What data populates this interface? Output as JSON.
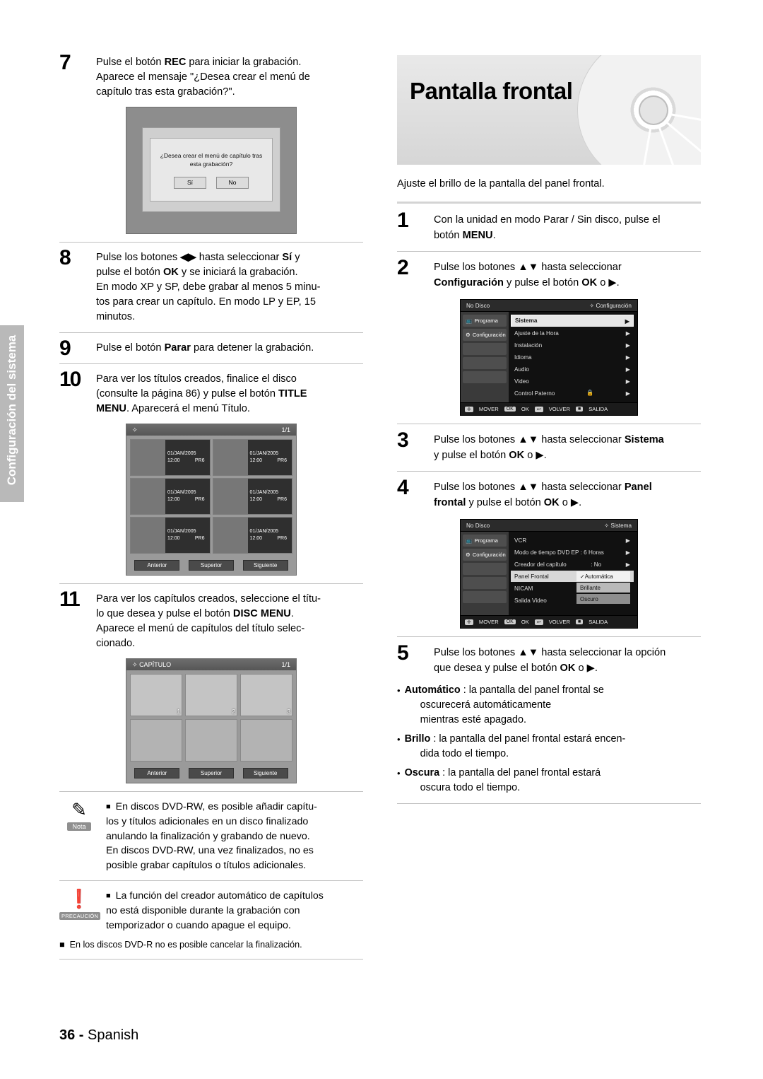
{
  "header": {
    "title": "Pantalla frontal",
    "intro": "Ajuste el brillo de la pantalla del panel frontal."
  },
  "left_steps": [
    {
      "num": "7",
      "lines": [
        "Pulse el botón REC para iniciar la grabación.",
        "Aparece el mensaje \"¿Desea crear el menú de",
        "capítulo tras esta grabación?\"."
      ]
    },
    {
      "num": "8",
      "lines": [
        "Pulse los botones ◀ ▶ hasta seleccionar Sí y",
        "pulse el botón OK y se iniciará la grabación.",
        "En modo XP y SP, debe grabar al menos 5 minu-",
        "tos para crear un capítulo. En modo LP y EP, 15",
        "minutos."
      ]
    },
    {
      "num": "9",
      "lines": [
        "Pulse el botón Parar para detener la grabación."
      ]
    },
    {
      "num": "10",
      "lines": [
        "Para ver los títulos creados, finalice el disco",
        "(consulte la página 86) y pulse el botón TITLE",
        "MENU. Aparecerá el menú Título."
      ]
    },
    {
      "num": "11",
      "lines": [
        "Para ver los capítulos creados, seleccione el títu-",
        "lo que desea y pulse el botón DISC MENU.",
        "Aparece el menú de capítulos del título selec-",
        "cionado."
      ]
    }
  ],
  "dialog_figure": {
    "line1": "¿Desea crear el menú de capítulo tras",
    "line2": "esta grabación?",
    "yes": "Sí",
    "no": "No"
  },
  "title_menu_figure": {
    "page": "1/1",
    "marker": "✧",
    "thumbs": [
      {
        "date": "01/JAN/2005",
        "time": "12:00",
        "mode": "PR6"
      },
      {
        "date": "01/JAN/2005",
        "time": "12:00",
        "mode": "PR6"
      },
      {
        "date": "01/JAN/2005",
        "time": "12:00",
        "mode": "PR6"
      },
      {
        "date": "01/JAN/2005",
        "time": "12:00",
        "mode": "PR6"
      },
      {
        "date": "01/JAN/2005",
        "time": "12:00",
        "mode": "PR6"
      },
      {
        "date": "01/JAN/2005",
        "time": "12:00",
        "mode": "PR6"
      }
    ],
    "nav": [
      "Anterior",
      "Superior",
      "Siguiente"
    ]
  },
  "chapter_menu_figure": {
    "title": "CAPÍTULO",
    "marker": "✧",
    "page": "1/1",
    "cells": [
      "1",
      "2",
      "3"
    ],
    "nav": [
      "Anterior",
      "Superior",
      "Siguiente"
    ]
  },
  "note_box": {
    "label": "Nota",
    "lines": [
      "En discos DVD-RW, es posible añadir capítu-",
      "los y títulos adicionales en un disco finalizado",
      "anulando la finalización y grabando de nuevo.",
      "En discos DVD-RW, una vez finalizados, no es",
      "posible grabar capítulos o títulos adicionales."
    ]
  },
  "caution_box": {
    "label": "PRECAUCIÓN",
    "lines": [
      "La función del creador automático de capítulos",
      "no está disponible durante la grabación con",
      "temporizador o cuando apague el equipo."
    ],
    "extra": "En los discos DVD-R no es posible cancelar la finalización."
  },
  "right_steps": [
    {
      "num": "1",
      "lines": [
        "Con la unidad en modo Parar / Sin disco, pulse el",
        "botón MENU."
      ]
    },
    {
      "num": "2",
      "lines": [
        "Pulse los botones ▲▼ hasta seleccionar",
        "Configuración y pulse el botón OK o ▶."
      ]
    },
    {
      "num": "3",
      "lines": [
        "Pulse los botones ▲▼ hasta seleccionar Sistema",
        "y pulse el botón OK o ▶."
      ]
    },
    {
      "num": "4",
      "lines": [
        "Pulse los botones ▲▼ hasta seleccionar Panel",
        "frontal y pulse el botón OK o ▶."
      ]
    },
    {
      "num": "5",
      "lines": [
        "Pulse los botones ▲▼ hasta seleccionar la opción",
        "que desea y pulse el botón OK o ▶."
      ]
    }
  ],
  "osd_setup": {
    "status": "No Disco",
    "title": "Configuración",
    "title_marker": "✧",
    "left_items": [
      "Programa",
      "Configuración"
    ],
    "rows": [
      {
        "label": "Sistema",
        "arrow": "▶",
        "selected": true
      },
      {
        "label": "Ajuste de la Hora",
        "arrow": "▶",
        "selected": false
      },
      {
        "label": "Instalación",
        "arrow": "▶",
        "selected": false
      },
      {
        "label": "Idioma",
        "arrow": "▶",
        "selected": false
      },
      {
        "label": "Audio",
        "arrow": "▶",
        "selected": false
      },
      {
        "label": "Video",
        "arrow": "▶",
        "selected": false
      },
      {
        "label": "Control Paterno",
        "arrow": "▶",
        "selected": false,
        "lock": true
      }
    ],
    "footer": [
      {
        "key": "✛",
        "label": "MOVER"
      },
      {
        "key": "OK",
        "label": "OK"
      },
      {
        "key": "↩",
        "label": "VOLVER"
      },
      {
        "key": "■",
        "label": "SALIDA"
      }
    ]
  },
  "osd_system": {
    "status": "No Disco",
    "title": "Sistema",
    "title_marker": "✧",
    "left_items": [
      "Programa",
      "Configuración"
    ],
    "rows": [
      {
        "label": "VCR",
        "arrow": "▶"
      },
      {
        "label": "Modo de tiempo DVD EP : 6 Horas",
        "arrow": "▶"
      },
      {
        "label": "Creador del capítulo",
        "value": ": No",
        "arrow": "▶"
      },
      {
        "label": "Panel Frontal",
        "arrow": "▶",
        "highlight": true
      },
      {
        "label": "NICAM",
        "arrow": "▶"
      },
      {
        "label": "Salida Video",
        "arrow": "▶"
      }
    ],
    "options": [
      {
        "label": "✓Automática",
        "state": "white"
      },
      {
        "label": "Brillante",
        "state": "grey"
      },
      {
        "label": "Oscuro",
        "state": "dark"
      }
    ],
    "footer": [
      {
        "key": "✛",
        "label": "MOVER"
      },
      {
        "key": "OK",
        "label": "OK"
      },
      {
        "key": "↩",
        "label": "VOLVER"
      },
      {
        "key": "■",
        "label": "SALIDA"
      }
    ]
  },
  "options_text": [
    {
      "name": "Automático",
      "rest": ": la pantalla del panel frontal se",
      "cont": [
        "oscurecerá automáticamente",
        "mientras esté apagado."
      ]
    },
    {
      "name": "Brillo",
      "rest": ": la pantalla del panel frontal estará encen-",
      "cont": [
        "dida todo el tiempo."
      ]
    },
    {
      "name": "Oscura",
      "rest": ": la pantalla del panel frontal estará",
      "cont": [
        "oscura todo el tiempo."
      ]
    }
  ],
  "sidebar": {
    "label": "Configuración del sistema"
  },
  "footer": {
    "page": "36 -",
    "language": "Spanish"
  }
}
